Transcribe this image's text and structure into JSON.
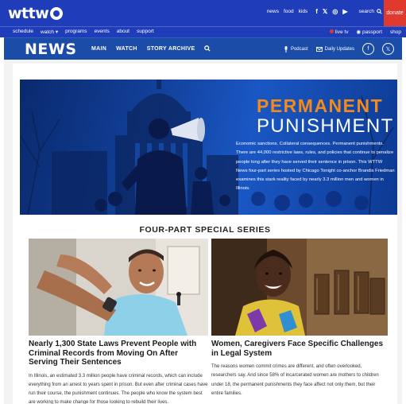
{
  "topbar": {
    "logo": "wttw",
    "links": [
      "news",
      "food",
      "kids"
    ],
    "social": [
      "f",
      "𝕏",
      "◎",
      "▶"
    ],
    "search": "search",
    "donate": "donate"
  },
  "subnav": {
    "left": [
      "schedule",
      "watch ▾",
      "programs",
      "events",
      "about",
      "support"
    ],
    "right": [
      "live tv",
      "passport",
      "shop"
    ]
  },
  "newsbar": {
    "logo": "NEWS",
    "nav": [
      "MAIN",
      "WATCH",
      "STORY ARCHIVE"
    ],
    "podcast": "Podcast",
    "daily_updates": "Daily Updates",
    "social": [
      "f",
      "𝕏"
    ]
  },
  "hero": {
    "title_line1": "PERMANENT",
    "title_line2": "PUNISHMENT",
    "description": "Economic sanctions. Collateral consequences. Permanent punishments. There are 44,000 restrictive laws, rules, and policies that continue to penalize people long after they have served their sentence in prison. This WTTW News four-part series hosted by Chicago Tonight co-anchor Brandis Friedman examines this stark reality faced by nearly 3.3 million men and women in Illinois."
  },
  "section_title": "FOUR-PART SPECIAL SERIES",
  "cards": [
    {
      "title": "Nearly 1,300 State Laws Prevent People with Criminal Records from Moving On After Serving Their Sentences",
      "body": "In Illinois, an estimated 3.3 million people have criminal records, which can include everything from an arrest to years spent in prison. But even after criminal cases have run their course, the punishment continues. The people who know the system best are working to make change for those looking to rebuild their lives."
    },
    {
      "title": "Women, Caregivers Face Specific Challenges in Legal System",
      "body": "The reasons women commit crimes are different, and often overlooked, researchers say. And since 58% of incarcerated women are mothers to children under 18, the permanent punishments they face affect not only them, but their entire families."
    }
  ],
  "colors": {
    "brand_blue": "#1f3db8",
    "news_blue": "#1a4ca8",
    "donate_red": "#e03a2f",
    "hero_orange": "#f28b1c"
  }
}
